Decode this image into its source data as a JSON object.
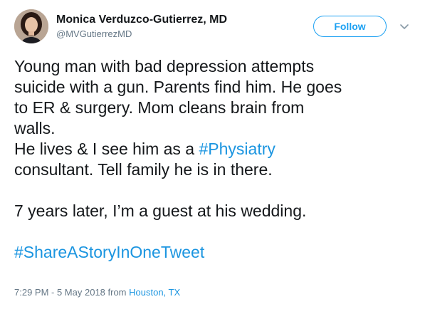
{
  "author": {
    "name": "Monica Verduzco-Gutierrez, MD",
    "handle": "@MVGutierrezMD"
  },
  "follow_label": "Follow",
  "icons": {
    "avatar": "profile-photo",
    "caret": "chevron-down-icon"
  },
  "tweet": {
    "line1": "Young man with bad depression attempts",
    "line2": "suicide with a gun. Parents find him. He goes",
    "line3": "to ER & surgery. Mom cleans brain from",
    "line4": "walls.",
    "line5_prefix": "He lives & I see him as a ",
    "line5_hashtag": "#Physiatry",
    "line6": "consultant. Tell family he is in there.",
    "line7": "7 years later, I’m a guest at his wedding.",
    "hashtag_final": "#ShareAStoryInOneTweet"
  },
  "meta": {
    "timestamp": "7:29 PM - 5 May 2018 from ",
    "location": "Houston, TX"
  },
  "colors": {
    "link": "#1b95e0",
    "button": "#1da1f2",
    "secondary_text": "#657786",
    "primary_text": "#14171a"
  }
}
